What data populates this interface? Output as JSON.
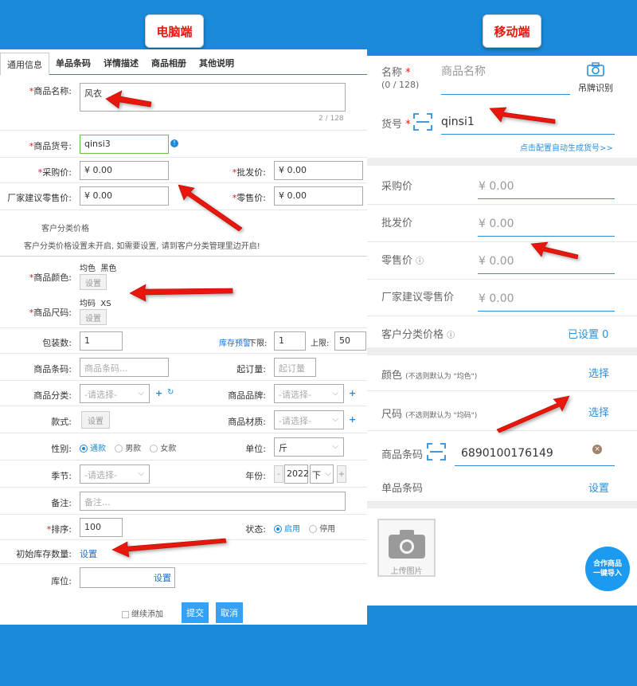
{
  "badges": {
    "pc": "电脑端",
    "mobile": "移动端"
  },
  "pc": {
    "tabs": [
      "通用信息",
      "单品条码",
      "详情描述",
      "商品相册",
      "其他说明"
    ],
    "name": {
      "label": "商品名称:",
      "value": "风衣",
      "counter": "2 / 128"
    },
    "sku": {
      "label": "商品货号:",
      "value": "qinsi3"
    },
    "purchase_price": {
      "label": "采购价:",
      "value": "¥ 0.00"
    },
    "wholesale_price": {
      "label": "批发价:",
      "value": "¥ 0.00"
    },
    "msrp": {
      "label": "厂家建议零售价:",
      "value": "¥ 0.00"
    },
    "retail_price": {
      "label": "零售价:",
      "value": "¥ 0.00"
    },
    "customer_pricing": {
      "title": "客户分类价格",
      "notice": "客户分类价格设置未开启, 如需要设置, 请到客户分类管理里边开启!"
    },
    "color": {
      "label": "商品颜色:",
      "values": "均色  黑色",
      "button": "设置"
    },
    "size": {
      "label": "商品尺码:",
      "values": "均码  XS",
      "button": "设置"
    },
    "pack": {
      "label": "包装数:",
      "value": "1"
    },
    "stock_warn": {
      "link": "库存预警",
      "lower_label": "下限:",
      "lower": "1",
      "upper_label": "上限:",
      "upper": "50"
    },
    "barcode": {
      "label": "商品条码:",
      "placeholder": "商品条码..."
    },
    "overorder": {
      "label": "起订量:",
      "placeholder": "起订量"
    },
    "category": {
      "label": "商品分类:",
      "value": "-请选择-"
    },
    "brand": {
      "label": "商品品牌:",
      "value": "-请选择-"
    },
    "style": {
      "label": "款式:",
      "button": "设置"
    },
    "material": {
      "label": "商品材质:",
      "value": "-请选择-"
    },
    "gender": {
      "label": "性别:",
      "options": [
        "通款",
        "男款",
        "女款"
      ]
    },
    "unit": {
      "label": "单位:",
      "value": "斤"
    },
    "season": {
      "label": "季节:",
      "value": "-请选择-"
    },
    "year": {
      "label": "年份:",
      "minus": "-",
      "value": "2022",
      "half": "下",
      "plus": "+"
    },
    "remark": {
      "label": "备注:",
      "placeholder": "备注..."
    },
    "sort": {
      "label": "排序:",
      "value": "100"
    },
    "status": {
      "label": "状态:",
      "options": [
        "启用",
        "停用"
      ]
    },
    "initial_stock": {
      "label": "初始库存数量:",
      "link": "设置"
    },
    "location": {
      "label": "库位:",
      "link": "设置"
    },
    "footer": {
      "continue": "继续添加",
      "submit": "提交",
      "cancel": "取消"
    }
  },
  "mobile": {
    "name": {
      "label": "名称",
      "count": "(0 / 128)",
      "placeholder": "商品名称",
      "tag_scan": "吊牌识别"
    },
    "sku": {
      "label": "货号",
      "value": "qinsi1",
      "auto_link": "点击配置自动生成货号>>"
    },
    "purchase": {
      "label": "采购价",
      "value": "¥ 0.00"
    },
    "wholesale": {
      "label": "批发价",
      "value": "¥ 0.00"
    },
    "retail": {
      "label": "零售价",
      "value": "¥ 0.00"
    },
    "msrp": {
      "label": "厂家建议零售价",
      "value": "¥ 0.00"
    },
    "customer": {
      "label": "客户分类价格",
      "value": "已设置 0"
    },
    "color": {
      "label": "颜色",
      "hint": "(不选则默认为 \"均色\")",
      "action": "选择"
    },
    "size": {
      "label": "尺码",
      "hint": "(不选则默认为 \"均码\")",
      "action": "选择"
    },
    "barcode": {
      "label": "商品条码",
      "value": "6890100176149"
    },
    "item_barcode": {
      "label": "单品条码",
      "action": "设置"
    },
    "upload": "上传图片",
    "fab": [
      "合作商品",
      "一键导入"
    ]
  }
}
